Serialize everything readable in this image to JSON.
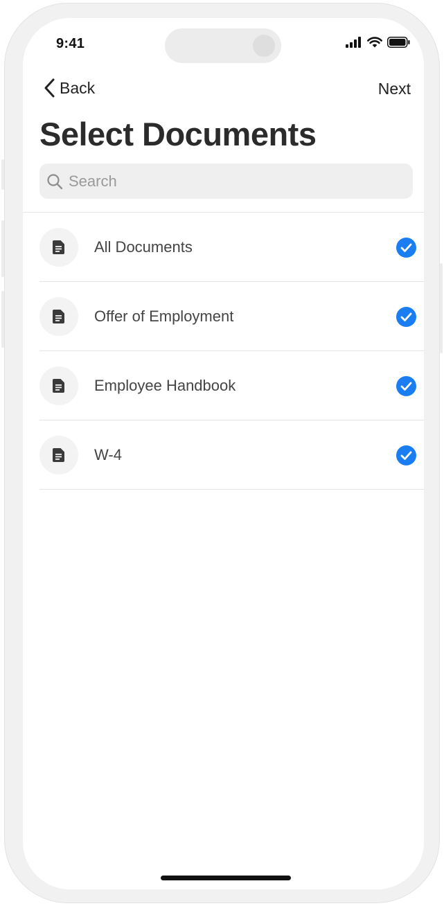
{
  "status_bar": {
    "time": "9:41",
    "icons": [
      "cellular-signal-icon",
      "wifi-icon",
      "battery-icon"
    ]
  },
  "nav": {
    "back_label": "Back",
    "next_label": "Next"
  },
  "page": {
    "title": "Select Documents"
  },
  "search": {
    "placeholder": "Search",
    "value": ""
  },
  "documents": [
    {
      "label": "All Documents",
      "selected": true,
      "icon": "document-icon"
    },
    {
      "label": "Offer of Employment",
      "selected": true,
      "icon": "document-icon"
    },
    {
      "label": "Employee Handbook",
      "selected": true,
      "icon": "document-icon"
    },
    {
      "label": "W-4",
      "selected": true,
      "icon": "document-icon"
    }
  ],
  "colors": {
    "accent": "#1a7ef2",
    "text_primary": "#2b2b2b",
    "divider": "#e4e4e4"
  }
}
